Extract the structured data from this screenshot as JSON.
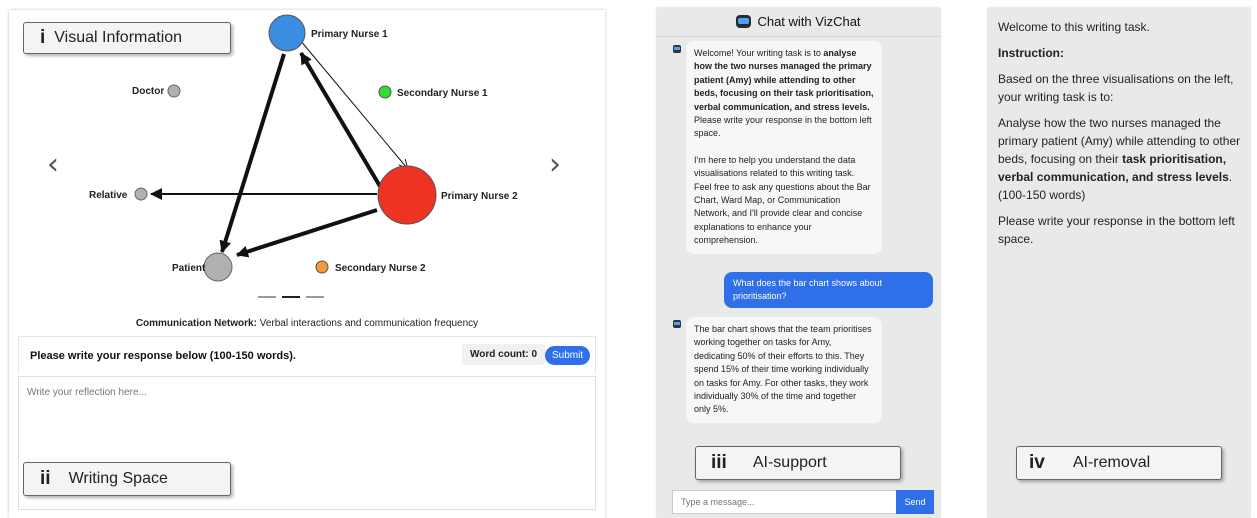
{
  "network": {
    "nodes": [
      {
        "id": "pn1",
        "label": "Primary Nurse 1",
        "color": "#3a8de0"
      },
      {
        "id": "doc",
        "label": "Doctor",
        "color": "#b0b0b0"
      },
      {
        "id": "sn1",
        "label": "Secondary Nurse 1",
        "color": "#33dd33"
      },
      {
        "id": "rel",
        "label": "Relative",
        "color": "#b0b0b0"
      },
      {
        "id": "pn2",
        "label": "Primary Nurse 2",
        "color": "#ee3322"
      },
      {
        "id": "pat",
        "label": "Patient",
        "color": "#b0b0b0"
      },
      {
        "id": "sn2",
        "label": "Secondary Nurse 2",
        "color": "#f39a3a"
      }
    ],
    "edges": [
      {
        "from": "pn2",
        "to": "pn1",
        "weight": "heavy"
      },
      {
        "from": "pn1",
        "to": "pn2",
        "weight": "light"
      },
      {
        "from": "pn1",
        "to": "pat",
        "weight": "heavy"
      },
      {
        "from": "pn2",
        "to": "pat",
        "weight": "heavy"
      },
      {
        "from": "pn2",
        "to": "rel",
        "weight": "medium"
      }
    ],
    "caption_bold": "Communication Network:",
    "caption_rest": " Verbal interactions and communication frequency",
    "prev_arrow": "‹",
    "next_arrow": "›"
  },
  "labels": {
    "visual_roman": "i",
    "visual_text": "Visual Information",
    "writing_roman": "ii",
    "writing_text": "Writing Space",
    "ai_support_roman": "iii",
    "ai_support_text": "AI-support",
    "ai_removal_roman": "iv",
    "ai_removal_text": "AI-removal"
  },
  "response": {
    "title": "Please write your response below (100-150 words).",
    "word_count": "Word count: 0",
    "submit_label": "Submit",
    "placeholder": "Write your reflection here..."
  },
  "chat": {
    "title": "Chat with VizChat",
    "welcome_pre": "Welcome! Your writing task is to ",
    "welcome_bold": "analyse how the two nurses managed the primary patient (Amy) while attending to other beds, focusing on their task prioritisation, verbal communication, and stress levels.",
    "welcome_post": " Please write your response in the bottom left space.",
    "welcome_p2": "I'm here to help you understand the data visualisations related to this writing task. Feel free to ask any questions about the Bar Chart, Ward Map, or Communication Network, and I'll provide clear and concise explanations to enhance your comprehension.",
    "user_message": "What does the bar chart shows about prioritisation?",
    "bot_reply": "The bar chart shows that the team prioritises working together on tasks for Amy, dedicating 50% of their efforts to this. They spend 15% of their time working individually on tasks for Amy. For other tasks, they work individually 30% of the time and together only 5%.",
    "input_placeholder": "Type a message...",
    "send_label": "Send"
  },
  "task": {
    "welcome": "Welcome to this writing task.",
    "instruction_heading": "Instruction:",
    "intro": "Based on the three visualisations on the left, your writing task is to:",
    "analyse_pre": "Analyse how the two nurses managed the primary patient (Amy) while attending to other beds, focusing on their ",
    "analyse_bold": "task prioritisation, verbal communication, and stress levels",
    "analyse_post": ".",
    "word_range": "(100-150 words)",
    "closing": "Please write your response in the bottom left space."
  }
}
